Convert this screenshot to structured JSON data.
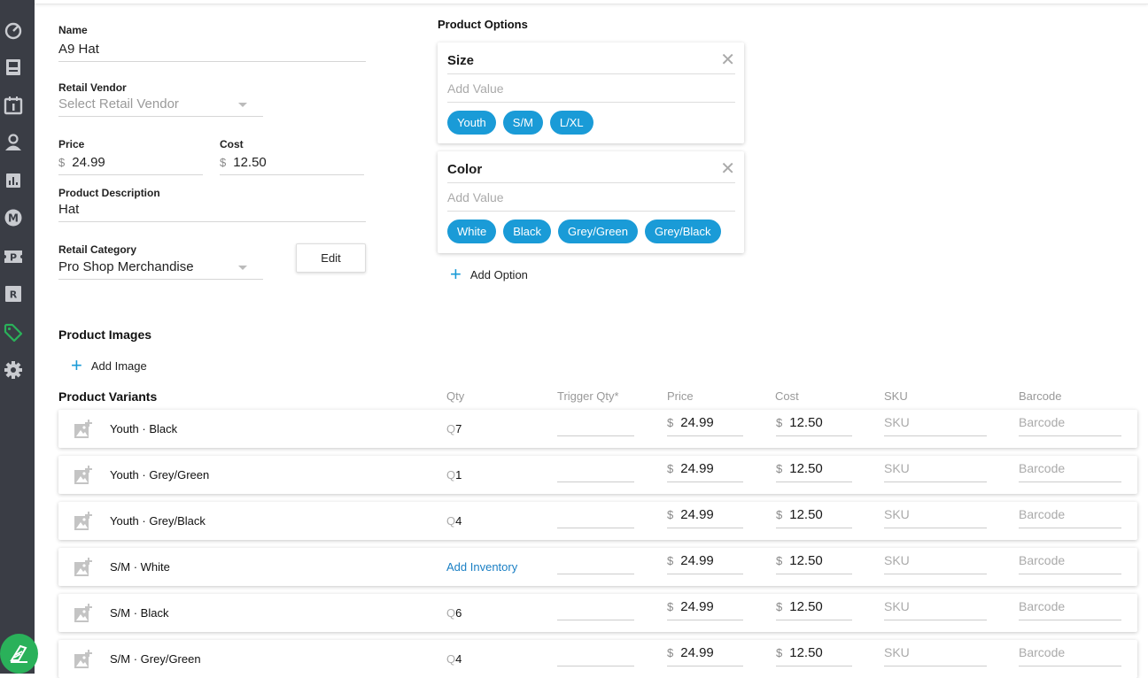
{
  "product": {
    "name_label": "Name",
    "name_value": "A9 Hat",
    "vendor_label": "Retail Vendor",
    "vendor_placeholder": "Select Retail Vendor",
    "price_label": "Price",
    "price_currency": "$",
    "price_value": "24.99",
    "cost_label": "Cost",
    "cost_currency": "$",
    "cost_value": "12.50",
    "description_label": "Product Description",
    "description_value": "Hat",
    "category_label": "Retail Category",
    "category_value": "Pro Shop Merchandise",
    "edit_label": "Edit"
  },
  "options": {
    "title": "Product Options",
    "items": [
      {
        "name": "Size",
        "add_placeholder": "Add Value",
        "values": [
          "Youth",
          "S/M",
          "L/XL"
        ]
      },
      {
        "name": "Color",
        "add_placeholder": "Add Value",
        "values": [
          "White",
          "Black",
          "Grey/Green",
          "Grey/Black"
        ]
      }
    ],
    "add_option_label": "Add Option"
  },
  "images": {
    "title": "Product Images",
    "add_image_label": "Add Image"
  },
  "variants": {
    "title": "Product Variants",
    "columns": {
      "qty": "Qty",
      "trigger": "Trigger Qty*",
      "price": "Price",
      "cost": "Cost",
      "sku": "SKU",
      "barcode": "Barcode"
    },
    "qty_prefix": "Q",
    "currency": "$",
    "rows": [
      {
        "name": "Youth · Black",
        "qty": "7",
        "price": "24.99",
        "cost": "12.50",
        "sku": "SKU",
        "barcode": "Barcode"
      },
      {
        "name": "Youth · Grey/Green",
        "qty": "1",
        "price": "24.99",
        "cost": "12.50",
        "sku": "SKU",
        "barcode": "Barcode"
      },
      {
        "name": "Youth · Grey/Black",
        "qty": "4",
        "price": "24.99",
        "cost": "12.50",
        "sku": "SKU",
        "barcode": "Barcode"
      },
      {
        "name": "S/M · White",
        "qty": "",
        "add_inventory": "Add Inventory",
        "price": "24.99",
        "cost": "12.50",
        "sku": "SKU",
        "barcode": "Barcode"
      },
      {
        "name": "S/M · Black",
        "qty": "6",
        "price": "24.99",
        "cost": "12.50",
        "sku": "SKU",
        "barcode": "Barcode"
      },
      {
        "name": "S/M · Grey/Green",
        "qty": "4",
        "price": "24.99",
        "cost": "12.50",
        "sku": "SKU",
        "barcode": "Barcode"
      }
    ]
  },
  "sidebar": {
    "items": [
      {
        "icon": "dashboard-gauge-icon"
      },
      {
        "icon": "book-icon"
      },
      {
        "icon": "calendar-icon"
      },
      {
        "icon": "members-icon"
      },
      {
        "icon": "reports-chart-icon"
      },
      {
        "icon": "marketing-m-icon"
      },
      {
        "icon": "pos-p-icon"
      },
      {
        "icon": "reservations-r-icon"
      },
      {
        "icon": "retail-tag-icon",
        "active": true
      },
      {
        "icon": "settings-gear-icon"
      }
    ],
    "active_color": "#2ab15a",
    "icon_color": "#c9cbd0"
  },
  "colors": {
    "accent": "#1a9bd7",
    "link": "#1a7fc4",
    "brand": "#2ab15a"
  }
}
